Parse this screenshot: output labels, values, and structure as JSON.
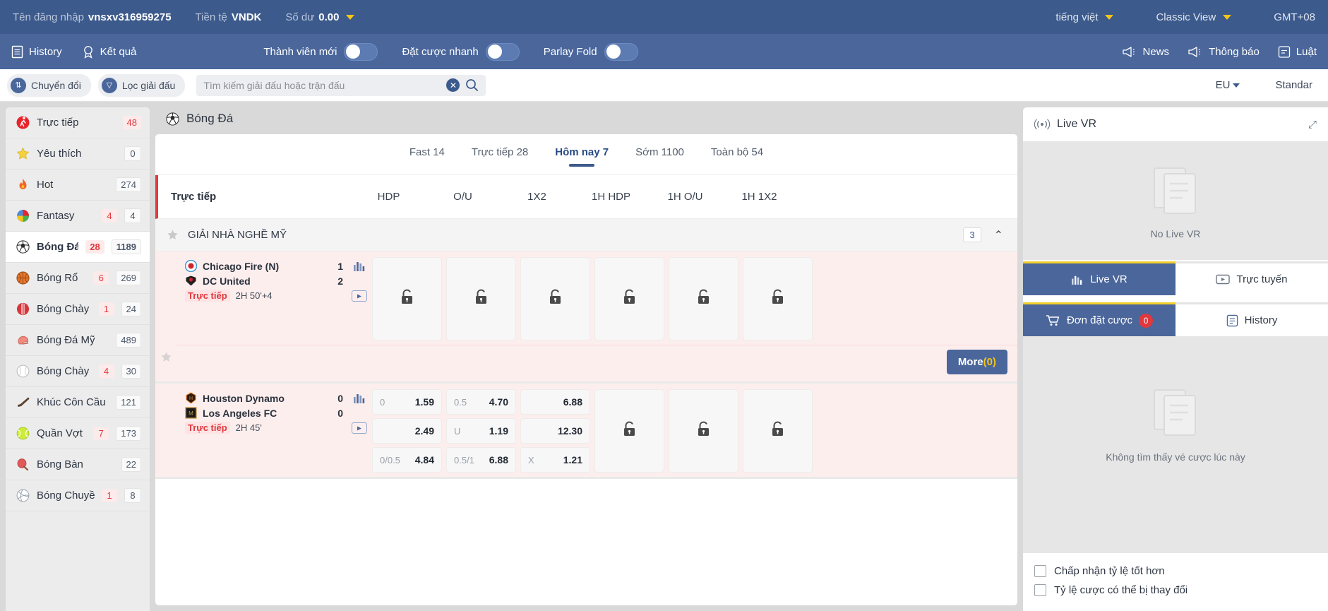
{
  "topbar": {
    "username_label": "Tên đăng nhập",
    "username_value": "vnsxv316959275",
    "currency_label": "Tiền tệ",
    "currency_value": "VNDK",
    "balance_label": "Số dư",
    "balance_value": "0.00",
    "language": "tiếng việt",
    "view_mode": "Classic View",
    "timezone": "GMT+08"
  },
  "navbar": {
    "history": "History",
    "results": "Kết quả",
    "new_member": "Thành viên mới",
    "quick_bet": "Đặt cược nhanh",
    "parlay_fold": "Parlay Fold",
    "news": "News",
    "notice": "Thông báo",
    "rules": "Luật"
  },
  "filterbar": {
    "switch": "Chuyển đổi",
    "league_filter": "Lọc giải đấu",
    "search_placeholder": "Tìm kiếm giải đấu hoặc trận đấu",
    "search_value": "",
    "odds_format": "EU",
    "layout": "Standar"
  },
  "sidebar": {
    "items": [
      {
        "label": "Trực tiếp",
        "icon": "live-running-icon",
        "red": "48",
        "gray": ""
      },
      {
        "label": "Yêu thích",
        "icon": "star-icon",
        "red": "",
        "gray": "0"
      },
      {
        "label": "Hot",
        "icon": "flame-icon",
        "red": "",
        "gray": "274"
      },
      {
        "label": "Fantasy",
        "icon": "fantasy-icon",
        "red": "4",
        "gray": "4"
      },
      {
        "label": "Bóng Đá",
        "icon": "soccer-icon",
        "red": "28",
        "gray": "1189"
      },
      {
        "label": "Bóng Rổ",
        "icon": "basketball-icon",
        "red": "6",
        "gray": "269"
      },
      {
        "label": "Bóng Chày",
        "icon": "cricket-ball-icon",
        "red": "1",
        "gray": "24"
      },
      {
        "label": "Bóng Đá Mỹ",
        "icon": "football-helmet-icon",
        "red": "",
        "gray": "489"
      },
      {
        "label": "Bóng Chày",
        "icon": "baseball-icon",
        "red": "4",
        "gray": "30"
      },
      {
        "label": "Khúc Côn Cầu",
        "icon": "hockey-stick-icon",
        "red": "",
        "gray": "121"
      },
      {
        "label": "Quần Vợt",
        "icon": "tennis-ball-icon",
        "red": "7",
        "gray": "173"
      },
      {
        "label": "Bóng Bàn",
        "icon": "table-tennis-icon",
        "red": "",
        "gray": "22"
      },
      {
        "label": "Bóng Chuyền",
        "icon": "volleyball-icon",
        "red": "1",
        "gray": "8"
      }
    ]
  },
  "main": {
    "title": "Bóng Đá",
    "tabs": [
      {
        "label": "Fast 14",
        "active": false
      },
      {
        "label": "Trực tiếp 28",
        "active": false
      },
      {
        "label": "Hôm nay 7",
        "active": true
      },
      {
        "label": "Sớm 1100",
        "active": false
      },
      {
        "label": "Toàn bộ 54",
        "active": false
      }
    ],
    "market_header": {
      "live": "Trực tiếp",
      "columns": [
        "HDP",
        "O/U",
        "1X2",
        "1H HDP",
        "1H O/U",
        "1H 1X2"
      ]
    },
    "league": {
      "name": "GIẢI NHÀ NGHỀ MỸ",
      "count": "3"
    },
    "more_label": "More",
    "more_count": "(0)",
    "matches": [
      {
        "home": "Chicago Fire (N)",
        "away": "DC United",
        "home_score": "1",
        "away_score": "2",
        "live_tag": "Trực tiếp",
        "clock": "2H 50'+4",
        "locked": true,
        "columns": [
          {
            "locked": true
          },
          {
            "locked": true
          },
          {
            "locked": true
          },
          {
            "locked": true
          },
          {
            "locked": true
          },
          {
            "locked": true
          }
        ]
      },
      {
        "home": "Houston Dynamo",
        "away": "Los Angeles FC",
        "home_score": "0",
        "away_score": "0",
        "live_tag": "Trực tiếp",
        "clock": "2H 45'",
        "locked": false,
        "columns": [
          {
            "locked": false,
            "cells": [
              {
                "hcp": "0",
                "val": "1.59"
              },
              {
                "hcp": "",
                "val": "2.49"
              }
            ]
          },
          {
            "locked": false,
            "cells": [
              {
                "hcp": "0.5",
                "val": "4.70"
              },
              {
                "hcp": "U",
                "val": "1.19"
              }
            ]
          },
          {
            "locked": false,
            "cells": [
              {
                "hcp": "",
                "val": "6.88"
              },
              {
                "hcp": "",
                "val": "12.30"
              },
              {
                "hcp": "X",
                "val": "1.21"
              }
            ]
          },
          {
            "locked": true
          },
          {
            "locked": true
          },
          {
            "locked": true
          }
        ],
        "extra_row": [
          {
            "hcp": "0/0.5",
            "val": "4.84"
          },
          {
            "hcp": "0.5/1",
            "val": "6.88"
          }
        ]
      }
    ]
  },
  "right": {
    "live_vr_title": "Live VR",
    "no_live_vr": "No Live VR",
    "tab_live_vr": "Live VR",
    "tab_stream": "Trực tuyến",
    "tab_betslip": "Đơn đặt cược",
    "betslip_count": "0",
    "tab_history": "History",
    "empty_slip": "Không tìm thấy vé cược lúc này",
    "opt_better_odds": "Chấp nhận tỷ lệ tốt hơn",
    "opt_odds_change": "Tỷ lệ cược có thể bị thay đổi"
  }
}
